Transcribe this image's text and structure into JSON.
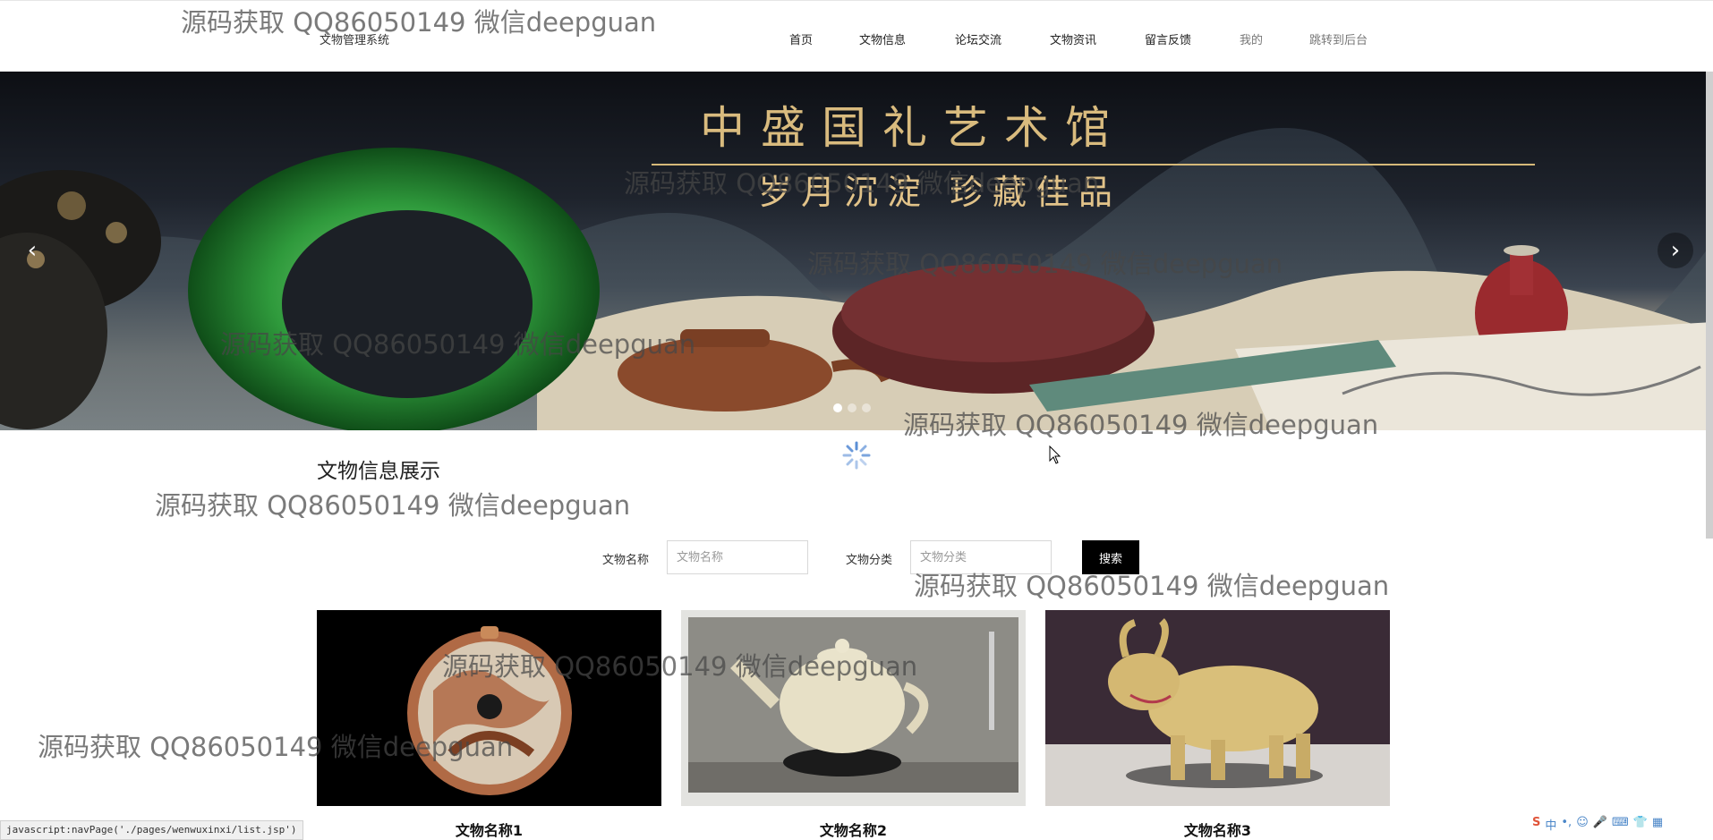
{
  "header": {
    "site_title": "文物管理系统",
    "nav": [
      "首页",
      "文物信息",
      "论坛交流",
      "文物资讯",
      "留言反馈",
      "我的",
      "跳转到后台"
    ]
  },
  "banner": {
    "title": "中盛国礼艺术馆",
    "subtitle": "岁月沉淀  珍藏佳品",
    "slides_count": 3,
    "active_slide": 1
  },
  "section": {
    "title": "文物信息展示",
    "search": {
      "name_label": "文物名称",
      "name_placeholder": "文物名称",
      "category_label": "文物分类",
      "category_placeholder": "文物分类",
      "button": "搜索"
    },
    "cards": [
      {
        "name": "文物名称1"
      },
      {
        "name": "文物名称2"
      },
      {
        "name": "文物名称3"
      }
    ]
  },
  "status_bar": {
    "url": "javascript:navPage('./pages/wenwuxinxi/list.jsp')"
  },
  "ime_tray": [
    "S",
    "中",
    "•,",
    "☺",
    "🎤",
    "⌨",
    "👕",
    "▦"
  ],
  "watermark_text": "源码获取 QQ86050149 微信deepguan",
  "colors": {
    "search_button_bg": "#000000",
    "jade_green": "#2f9a3c",
    "header_bg": "#ffffff"
  }
}
